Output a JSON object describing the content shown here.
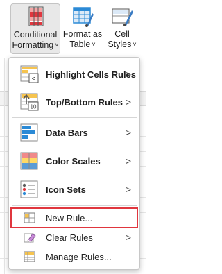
{
  "ribbon": {
    "conditional_formatting": {
      "line1": "Conditional",
      "line2": "Formatting",
      "chevron": "˅"
    },
    "format_as_table": {
      "line1": "Format as",
      "line2": "Table",
      "chevron": "˅"
    },
    "cell_styles": {
      "line1": "Cell",
      "line2": "Styles",
      "chevron": "˅"
    }
  },
  "menu": {
    "items": [
      {
        "label": "Highlight Cells Rules",
        "icon": "highlight-cells-icon",
        "submenu": ">"
      },
      {
        "label": "Top/Bottom Rules",
        "icon": "top-bottom-icon",
        "submenu": ">"
      },
      {
        "label": "Data Bars",
        "icon": "data-bars-icon",
        "submenu": ">"
      },
      {
        "label": "Color Scales",
        "icon": "color-scales-icon",
        "submenu": ">"
      },
      {
        "label": "Icon Sets",
        "icon": "icon-sets-icon",
        "submenu": ">"
      },
      {
        "label": "New Rule...",
        "icon": "new-rule-icon"
      },
      {
        "label": "Clear Rules",
        "icon": "clear-rules-icon",
        "submenu": ">"
      },
      {
        "label": "Manage Rules...",
        "icon": "manage-rules-icon"
      }
    ],
    "topbottom_icon_text": "10",
    "highlight_icon_text": "<"
  },
  "colors": {
    "accent_red": "#e0363e",
    "bar_blue": "#2b8ad6",
    "scale_red": "#f08a8a",
    "scale_yellow": "#ffd966"
  }
}
